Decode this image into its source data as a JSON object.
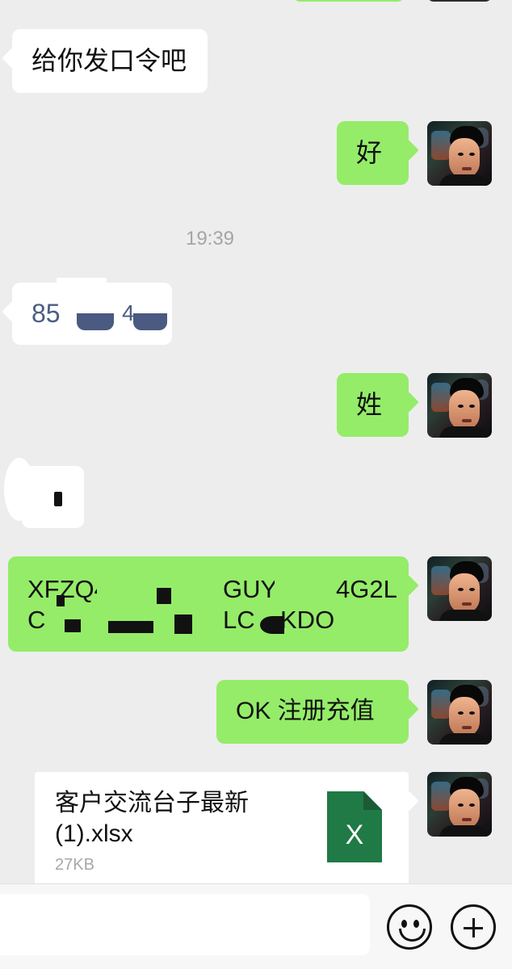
{
  "messages": {
    "left_1": "给你发口令吧",
    "right_1": "好",
    "time_1": "19:39",
    "left_code": "85",
    "left_code_tail": "4",
    "right_2": "姓",
    "right_long_line1": "XFZQ4",
    "right_long_line2": "C",
    "right_long_visible_a": "GUY",
    "right_long_visible_b": "4G2L",
    "right_long_visible_c": "LC",
    "right_long_visible_d": "KDO",
    "right_3": "OK 注册充值"
  },
  "file": {
    "name": "客户交流台子最新(1).xlsx",
    "name_line1": "客户交流台子最新",
    "name_line2": "(1).xlsx",
    "size": "27KB",
    "icon_letter": "X"
  },
  "colors": {
    "background": "#ededed",
    "sent_bubble": "#95ec69",
    "received_bubble": "#ffffff",
    "excel_green": "#1f7a45"
  },
  "icons": {
    "emoji": "emoji-icon",
    "plus": "plus-icon",
    "excel": "excel-icon"
  }
}
